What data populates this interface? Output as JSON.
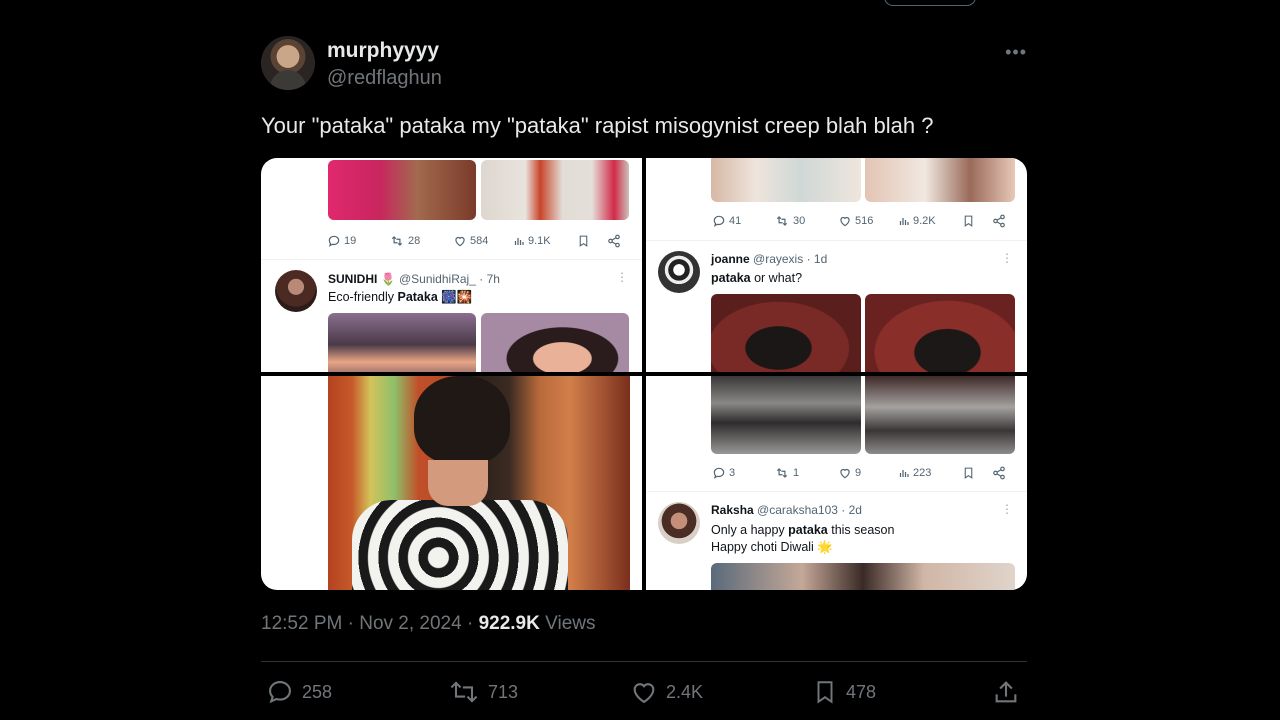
{
  "tweet": {
    "display_name": "murphyyyy",
    "handle": "@redflaghun",
    "text": "Your \"pataka\" pataka my \"pataka\" rapist misogynist creep blah blah ?",
    "time": "12:52 PM",
    "date": "Nov 2, 2024",
    "views_count": "922.9K",
    "views_label": "Views",
    "more_icon": "•••"
  },
  "actions": {
    "replies": "258",
    "reposts": "713",
    "likes": "2.4K",
    "bookmarks": "478"
  },
  "media": {
    "top_left": {
      "stats": {
        "replies": "19",
        "reposts": "28",
        "likes": "584",
        "views": "9.1K"
      },
      "post": {
        "name": "SUNIDHI",
        "name_emoji": "🌷",
        "handle": "@SunidhiRaj_",
        "time": "· 7h",
        "text_prefix": "Eco-friendly ",
        "text_bold": "Pataka",
        "text_suffix": " 🎆🎇"
      }
    },
    "top_right": {
      "stats": {
        "replies": "41",
        "reposts": "30",
        "likes": "516",
        "views": "9.2K"
      },
      "post": {
        "name": "joanne",
        "handle": "@rayexis",
        "time": "· 1d",
        "text_bold": "pataka",
        "text_suffix": " or what?"
      }
    },
    "bottom_right": {
      "stats": {
        "replies": "3",
        "reposts": "1",
        "likes": "9",
        "views": "223"
      },
      "post": {
        "name": "Raksha",
        "handle": "@caraksha103",
        "time": "· 2d",
        "line1_prefix": "Only a happy ",
        "line1_bold": "pataka",
        "line1_suffix": " this season",
        "line2": "Happy choti Diwali 🌟"
      }
    }
  },
  "colors": {
    "background": "#000000",
    "text_primary": "#e7e9ea",
    "text_secondary": "#71767b",
    "border": "#2f3336"
  }
}
